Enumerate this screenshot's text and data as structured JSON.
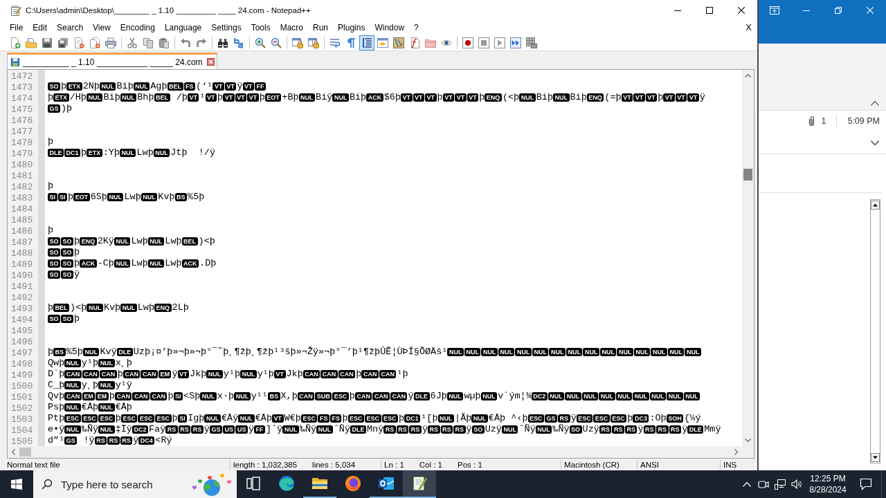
{
  "editor_window": {
    "title": "C:\\Users\\admin\\Desktop\\________ _ 1.10 _________ ____ 24.com - Notepad++",
    "menu": [
      "File",
      "Edit",
      "Search",
      "View",
      "Encoding",
      "Language",
      "Settings",
      "Tools",
      "Macro",
      "Run",
      "Plugins",
      "Window",
      "?"
    ],
    "menu_close": "X",
    "toolbar": [
      {
        "on": false
      },
      {
        "on": false
      },
      {
        "on": false
      },
      {
        "on": false
      },
      {
        "on": false
      },
      {
        "on": false
      },
      {
        "on": false
      },
      {
        "on": false
      },
      {
        "on": false
      },
      {
        "on": false
      },
      {
        "on": false
      },
      {
        "on": false
      },
      {
        "on": false
      },
      {
        "on": false
      },
      {
        "on": false
      },
      {
        "on": false
      },
      {
        "on": false
      },
      {
        "on": false
      },
      {
        "on": false
      },
      {
        "on": false
      },
      {
        "on": true
      },
      {
        "on": false
      },
      {
        "on": false
      },
      {
        "on": false
      },
      {
        "on": false
      },
      {
        "on": false
      },
      {
        "on": false
      },
      {
        "on": false
      },
      {
        "on": false
      },
      {
        "on": false
      },
      {
        "on": false
      }
    ],
    "tabs": [
      {
        "label": "__________ _ 1.10 ___________ _____ 24.com",
        "selected": true
      }
    ],
    "lines": [
      {
        "number": "1472"
      },
      {
        "number": "1473",
        "segments": [
          {
            "kind": "ctrl",
            "text": "SO"
          },
          {
            "kind": "text",
            "text": "þ"
          },
          {
            "kind": "ctrl",
            "text": "ETX"
          },
          {
            "kind": "text",
            "text": "2Nþ"
          },
          {
            "kind": "ctrl",
            "text": "NUL"
          },
          {
            "kind": "text",
            "text": "Biþ"
          },
          {
            "kind": "ctrl",
            "text": "NUL"
          },
          {
            "kind": "text",
            "text": "Agþ"
          },
          {
            "kind": "ctrl",
            "text": "BEL"
          },
          {
            "kind": "ctrl",
            "text": "FS"
          },
          {
            "kind": "text",
            "text": "(‘¹"
          },
          {
            "kind": "ctrl",
            "text": "VT"
          },
          {
            "kind": "ctrl",
            "text": "VT"
          },
          {
            "kind": "text",
            "text": "ÿ"
          },
          {
            "kind": "ctrl",
            "text": "VT"
          },
          {
            "kind": "ctrl",
            "text": "FF"
          }
        ]
      },
      {
        "number": "1474",
        "segments": [
          {
            "kind": "text",
            "text": "þ"
          },
          {
            "kind": "ctrl",
            "text": "ETX"
          },
          {
            "kind": "text",
            "text": "/Hþ"
          },
          {
            "kind": "ctrl",
            "text": "NUL"
          },
          {
            "kind": "text",
            "text": "Biþ"
          },
          {
            "kind": "ctrl",
            "text": "NUL"
          },
          {
            "kind": "text",
            "text": "Bhþ"
          },
          {
            "kind": "ctrl",
            "text": "BEL"
          },
          {
            "kind": "text",
            "text": " /þ"
          },
          {
            "kind": "ctrl",
            "text": "VT"
          },
          {
            "kind": "text",
            "text": "¹"
          },
          {
            "kind": "ctrl",
            "text": "VT"
          },
          {
            "kind": "text",
            "text": "þ"
          },
          {
            "kind": "ctrl",
            "text": "VT"
          },
          {
            "kind": "ctrl",
            "text": "VT"
          },
          {
            "kind": "ctrl",
            "text": "VT"
          },
          {
            "kind": "text",
            "text": "þ"
          },
          {
            "kind": "ctrl",
            "text": "EOT"
          },
          {
            "kind": "text",
            "text": "+Bþ"
          },
          {
            "kind": "ctrl",
            "text": "NUL"
          },
          {
            "kind": "text",
            "text": "Biÿ"
          },
          {
            "kind": "ctrl",
            "text": "NUL"
          },
          {
            "kind": "text",
            "text": "Biþ"
          },
          {
            "kind": "ctrl",
            "text": "ACK"
          },
          {
            "kind": "text",
            "text": "$6þ"
          },
          {
            "kind": "ctrl",
            "text": "VT"
          },
          {
            "kind": "ctrl",
            "text": "VT"
          },
          {
            "kind": "ctrl",
            "text": "VT"
          },
          {
            "kind": "text",
            "text": "þ"
          },
          {
            "kind": "ctrl",
            "text": "VT"
          },
          {
            "kind": "ctrl",
            "text": "VT"
          },
          {
            "kind": "ctrl",
            "text": "VT"
          },
          {
            "kind": "text",
            "text": "þ"
          },
          {
            "kind": "ctrl",
            "text": "ENQ"
          },
          {
            "kind": "text",
            "text": "(<þ"
          },
          {
            "kind": "ctrl",
            "text": "NUL"
          },
          {
            "kind": "text",
            "text": "Biþ"
          },
          {
            "kind": "ctrl",
            "text": "NUL"
          },
          {
            "kind": "text",
            "text": "Biþ"
          },
          {
            "kind": "ctrl",
            "text": "ENQ"
          },
          {
            "kind": "text",
            "text": "(=þ"
          },
          {
            "kind": "ctrl",
            "text": "VT"
          },
          {
            "kind": "ctrl",
            "text": "VT"
          },
          {
            "kind": "ctrl",
            "text": "VT"
          },
          {
            "kind": "text",
            "text": "þ"
          },
          {
            "kind": "ctrl",
            "text": "VT"
          },
          {
            "kind": "ctrl",
            "text": "VT"
          },
          {
            "kind": "ctrl",
            "text": "VT"
          },
          {
            "kind": "text",
            "text": "ÿ"
          }
        ]
      },
      {
        "number": "1475",
        "segments": [
          {
            "kind": "ctrl",
            "text": "GS"
          },
          {
            "kind": "text",
            "text": ")þ"
          }
        ]
      },
      {
        "number": "1476"
      },
      {
        "number": "1477"
      },
      {
        "number": "1478",
        "segments": [
          {
            "kind": "text",
            "text": "þ"
          }
        ]
      },
      {
        "number": "1479",
        "segments": [
          {
            "kind": "ctrl",
            "text": "DLE"
          },
          {
            "kind": "ctrl",
            "text": "DC1"
          },
          {
            "kind": "text",
            "text": "þ"
          },
          {
            "kind": "ctrl",
            "text": "ETX"
          },
          {
            "kind": "text",
            "text": ":Yþ"
          },
          {
            "kind": "ctrl",
            "text": "NUL"
          },
          {
            "kind": "text",
            "text": "Lwþ"
          },
          {
            "kind": "ctrl",
            "text": "NUL"
          },
          {
            "kind": "text",
            "text": "Jtþ  !/ÿ"
          }
        ]
      },
      {
        "number": "1480"
      },
      {
        "number": "1481"
      },
      {
        "number": "1482",
        "segments": [
          {
            "kind": "text",
            "text": "þ"
          }
        ]
      },
      {
        "number": "1483",
        "segments": [
          {
            "kind": "ctrl",
            "text": "SI"
          },
          {
            "kind": "ctrl",
            "text": "SI"
          },
          {
            "kind": "text",
            "text": "þ"
          },
          {
            "kind": "ctrl",
            "text": "EOT"
          },
          {
            "kind": "text",
            "text": "6Sþ"
          },
          {
            "kind": "ctrl",
            "text": "NUL"
          },
          {
            "kind": "text",
            "text": "Lwþ"
          },
          {
            "kind": "ctrl",
            "text": "NUL"
          },
          {
            "kind": "text",
            "text": "Kvþ"
          },
          {
            "kind": "ctrl",
            "text": "BS"
          },
          {
            "kind": "text",
            "text": "%5þ"
          }
        ]
      },
      {
        "number": "1484"
      },
      {
        "number": "1485"
      },
      {
        "number": "1486",
        "segments": [
          {
            "kind": "text",
            "text": "þ"
          }
        ]
      },
      {
        "number": "1487",
        "segments": [
          {
            "kind": "ctrl",
            "text": "SO"
          },
          {
            "kind": "ctrl",
            "text": "SO"
          },
          {
            "kind": "text",
            "text": "þ"
          },
          {
            "kind": "ctrl",
            "text": "ENQ"
          },
          {
            "kind": "text",
            "text": "2Kÿ"
          },
          {
            "kind": "ctrl",
            "text": "NUL"
          },
          {
            "kind": "text",
            "text": "Lwþ"
          },
          {
            "kind": "ctrl",
            "text": "NUL"
          },
          {
            "kind": "text",
            "text": "Lwþ"
          },
          {
            "kind": "ctrl",
            "text": "BEL"
          },
          {
            "kind": "text",
            "text": ")<þ"
          }
        ]
      },
      {
        "number": "1488",
        "segments": [
          {
            "kind": "ctrl",
            "text": "SO"
          },
          {
            "kind": "ctrl",
            "text": "SO"
          },
          {
            "kind": "text",
            "text": "þ"
          }
        ]
      },
      {
        "number": "1489",
        "segments": [
          {
            "kind": "ctrl",
            "text": "SO"
          },
          {
            "kind": "ctrl",
            "text": "SO"
          },
          {
            "kind": "text",
            "text": "þ"
          },
          {
            "kind": "ctrl",
            "text": "ACK"
          },
          {
            "kind": "text",
            "text": "-Cþ"
          },
          {
            "kind": "ctrl",
            "text": "NUL"
          },
          {
            "kind": "text",
            "text": "Lwþ"
          },
          {
            "kind": "ctrl",
            "text": "NUL"
          },
          {
            "kind": "text",
            "text": "Lwþ"
          },
          {
            "kind": "ctrl",
            "text": "ACK"
          },
          {
            "kind": "text",
            "text": ".Dþ"
          }
        ]
      },
      {
        "number": "1490",
        "segments": [
          {
            "kind": "ctrl",
            "text": "SO"
          },
          {
            "kind": "ctrl",
            "text": "SO"
          },
          {
            "kind": "text",
            "text": "ÿ"
          }
        ]
      },
      {
        "number": "1491"
      },
      {
        "number": "1492"
      },
      {
        "number": "1493",
        "segments": [
          {
            "kind": "text",
            "text": "þ"
          },
          {
            "kind": "ctrl",
            "text": "BEL"
          },
          {
            "kind": "text",
            "text": ")<þ"
          },
          {
            "kind": "ctrl",
            "text": "NUL"
          },
          {
            "kind": "text",
            "text": "Kvþ"
          },
          {
            "kind": "ctrl",
            "text": "NUL"
          },
          {
            "kind": "text",
            "text": "Lwþ"
          },
          {
            "kind": "ctrl",
            "text": "ENQ"
          },
          {
            "kind": "text",
            "text": "2Lþ"
          }
        ]
      },
      {
        "number": "1494",
        "segments": [
          {
            "kind": "ctrl",
            "text": "SO"
          },
          {
            "kind": "ctrl",
            "text": "SO"
          },
          {
            "kind": "text",
            "text": "þ"
          }
        ]
      },
      {
        "number": "1495"
      },
      {
        "number": "1496"
      },
      {
        "number": "1497",
        "segments": [
          {
            "kind": "text",
            "text": "þ"
          },
          {
            "kind": "ctrl",
            "text": "BS"
          },
          {
            "kind": "text",
            "text": "%5þ"
          },
          {
            "kind": "ctrl",
            "text": "NUL"
          },
          {
            "kind": "text",
            "text": "Kvÿ"
          },
          {
            "kind": "ctrl",
            "text": "DLE"
          },
          {
            "kind": "text",
            "text": "Uzþ¡¤’þ»¬þ»¬þ°¯˜þ¸¶žþ¸¶žþ¹³šþ»¬Žÿ»¬þ°¯’þ¹¶žþÛÊ¦ÙÞÍ§ÕØÄš¹"
          },
          {
            "kind": "ctrl",
            "text": "NUL"
          },
          {
            "kind": "ctrl",
            "text": "NUL"
          },
          {
            "kind": "ctrl",
            "text": "NUL"
          },
          {
            "kind": "ctrl",
            "text": "NUL"
          },
          {
            "kind": "ctrl",
            "text": "NUL"
          },
          {
            "kind": "ctrl",
            "text": "NUL"
          },
          {
            "kind": "ctrl",
            "text": "NUL"
          },
          {
            "kind": "ctrl",
            "text": "NUL"
          },
          {
            "kind": "ctrl",
            "text": "NUL"
          },
          {
            "kind": "ctrl",
            "text": "NUL"
          },
          {
            "kind": "ctrl",
            "text": "NUL"
          },
          {
            "kind": "ctrl",
            "text": "NUL"
          },
          {
            "kind": "ctrl",
            "text": "NUL"
          },
          {
            "kind": "ctrl",
            "text": "NUL"
          },
          {
            "kind": "ctrl",
            "text": "NUL"
          }
        ]
      },
      {
        "number": "1498",
        "segments": [
          {
            "kind": "text",
            "text": "Qwþ"
          },
          {
            "kind": "ctrl",
            "text": "NUL"
          },
          {
            "kind": "text",
            "text": "y¹þ"
          },
          {
            "kind": "ctrl",
            "text": "NUL"
          },
          {
            "kind": "text",
            "text": "x¸þ"
          }
        ]
      },
      {
        "number": "1499",
        "segments": [
          {
            "kind": "text",
            "text": "D`þ"
          },
          {
            "kind": "ctrl",
            "text": "CAN"
          },
          {
            "kind": "ctrl",
            "text": "CAN"
          },
          {
            "kind": "ctrl",
            "text": "CAN"
          },
          {
            "kind": "text",
            "text": "þ"
          },
          {
            "kind": "ctrl",
            "text": "CAN"
          },
          {
            "kind": "ctrl",
            "text": "CAN"
          },
          {
            "kind": "ctrl",
            "text": "EM"
          },
          {
            "kind": "text",
            "text": "ÿ"
          },
          {
            "kind": "ctrl",
            "text": "VT"
          },
          {
            "kind": "text",
            "text": "Jkþ"
          },
          {
            "kind": "ctrl",
            "text": "NUL"
          },
          {
            "kind": "text",
            "text": "y¹þ"
          },
          {
            "kind": "ctrl",
            "text": "NUL"
          },
          {
            "kind": "text",
            "text": "y¹þ"
          },
          {
            "kind": "ctrl",
            "text": "VT"
          },
          {
            "kind": "text",
            "text": "Jkþ"
          },
          {
            "kind": "ctrl",
            "text": "CAN"
          },
          {
            "kind": "ctrl",
            "text": "CAN"
          },
          {
            "kind": "ctrl",
            "text": "CAN"
          },
          {
            "kind": "text",
            "text": "þ"
          },
          {
            "kind": "ctrl",
            "text": "CAN"
          },
          {
            "kind": "ctrl",
            "text": "CAN"
          },
          {
            "kind": "text",
            "text": "¹þ"
          }
        ]
      },
      {
        "number": "1500",
        "segments": [
          {
            "kind": "text",
            "text": "C_þ"
          },
          {
            "kind": "ctrl",
            "text": "NUL"
          },
          {
            "kind": "text",
            "text": "y¸þ"
          },
          {
            "kind": "ctrl",
            "text": "NUL"
          },
          {
            "kind": "text",
            "text": "y¹ÿ"
          }
        ]
      },
      {
        "number": "1501",
        "segments": [
          {
            "kind": "text",
            "text": "Qvþ"
          },
          {
            "kind": "ctrl",
            "text": "CAN"
          },
          {
            "kind": "ctrl",
            "text": "EM"
          },
          {
            "kind": "ctrl",
            "text": "EM"
          },
          {
            "kind": "text",
            "text": "þ"
          },
          {
            "kind": "ctrl",
            "text": "CAN"
          },
          {
            "kind": "ctrl",
            "text": "CAN"
          },
          {
            "kind": "ctrl",
            "text": "CAN"
          },
          {
            "kind": "text",
            "text": "þ"
          },
          {
            "kind": "ctrl",
            "text": "SI"
          },
          {
            "kind": "text",
            "text": "<Sþ"
          },
          {
            "kind": "ctrl",
            "text": "NUL"
          },
          {
            "kind": "text",
            "text": "x·þ"
          },
          {
            "kind": "ctrl",
            "text": "NUL"
          },
          {
            "kind": "text",
            "text": "y¹¹"
          },
          {
            "kind": "ctrl",
            "text": "BS"
          },
          {
            "kind": "text",
            "text": "X,þ"
          },
          {
            "kind": "ctrl",
            "text": "CAN"
          },
          {
            "kind": "ctrl",
            "text": "SUB"
          },
          {
            "kind": "ctrl",
            "text": "ESC"
          },
          {
            "kind": "text",
            "text": "þ"
          },
          {
            "kind": "ctrl",
            "text": "CAN"
          },
          {
            "kind": "ctrl",
            "text": "CAN"
          },
          {
            "kind": "ctrl",
            "text": "CAN"
          },
          {
            "kind": "text",
            "text": "ÿ"
          },
          {
            "kind": "ctrl",
            "text": "DLE"
          },
          {
            "kind": "text",
            "text": "6Jþ"
          },
          {
            "kind": "ctrl",
            "text": "NUL"
          },
          {
            "kind": "text",
            "text": "wµþ"
          },
          {
            "kind": "ctrl",
            "text": "NUL"
          },
          {
            "kind": "text",
            "text": "v´ým¦¾"
          },
          {
            "kind": "ctrl",
            "text": "DC2"
          },
          {
            "kind": "ctrl",
            "text": "NUL"
          },
          {
            "kind": "ctrl",
            "text": "NUL"
          },
          {
            "kind": "ctrl",
            "text": "NUL"
          },
          {
            "kind": "ctrl",
            "text": "NUL"
          },
          {
            "kind": "ctrl",
            "text": "NUL"
          },
          {
            "kind": "ctrl",
            "text": "NUL"
          },
          {
            "kind": "ctrl",
            "text": "NUL"
          },
          {
            "kind": "ctrl",
            "text": "NUL"
          },
          {
            "kind": "ctrl",
            "text": "NUL"
          }
        ]
      },
      {
        "number": "1502",
        "segments": [
          {
            "kind": "text",
            "text": "Psþ"
          },
          {
            "kind": "ctrl",
            "text": "NUL"
          },
          {
            "kind": "text",
            "text": "€Åþ"
          },
          {
            "kind": "ctrl",
            "text": "NUL"
          },
          {
            "kind": "text",
            "text": "€Åþ"
          }
        ]
      },
      {
        "number": "1503",
        "segments": [
          {
            "kind": "text",
            "text": "Ptþ"
          },
          {
            "kind": "ctrl",
            "text": "ESC"
          },
          {
            "kind": "ctrl",
            "text": "ESC"
          },
          {
            "kind": "ctrl",
            "text": "ESC"
          },
          {
            "kind": "text",
            "text": "þ"
          },
          {
            "kind": "ctrl",
            "text": "ESC"
          },
          {
            "kind": "ctrl",
            "text": "ESC"
          },
          {
            "kind": "ctrl",
            "text": "ESC"
          },
          {
            "kind": "text",
            "text": "þ"
          },
          {
            "kind": "ctrl",
            "text": "SI"
          },
          {
            "kind": "text",
            "text": "Igþ"
          },
          {
            "kind": "ctrl",
            "text": "NUL"
          },
          {
            "kind": "text",
            "text": "€Åÿ"
          },
          {
            "kind": "ctrl",
            "text": "NUL"
          },
          {
            "kind": "text",
            "text": "€Åþ"
          },
          {
            "kind": "ctrl",
            "text": "VT"
          },
          {
            "kind": "text",
            "text": "W€þ"
          },
          {
            "kind": "ctrl",
            "text": "ESC"
          },
          {
            "kind": "ctrl",
            "text": "FS"
          },
          {
            "kind": "ctrl",
            "text": "FS"
          },
          {
            "kind": "text",
            "text": "þ"
          },
          {
            "kind": "ctrl",
            "text": "ESC"
          },
          {
            "kind": "ctrl",
            "text": "ESC"
          },
          {
            "kind": "ctrl",
            "text": "ESC"
          },
          {
            "kind": "text",
            "text": "þ"
          },
          {
            "kind": "ctrl",
            "text": "DC1"
          },
          {
            "kind": "text",
            "text": "¹[þ"
          },
          {
            "kind": "ctrl",
            "text": "NUL"
          },
          {
            "kind": "text",
            "text": "|Ãþ"
          },
          {
            "kind": "ctrl",
            "text": "NUL"
          },
          {
            "kind": "text",
            "text": "€Åþ ^‹þ"
          },
          {
            "kind": "ctrl",
            "text": "ESC"
          },
          {
            "kind": "ctrl",
            "text": "GS"
          },
          {
            "kind": "ctrl",
            "text": "RS"
          },
          {
            "kind": "text",
            "text": "ÿ"
          },
          {
            "kind": "ctrl",
            "text": "ESC"
          },
          {
            "kind": "ctrl",
            "text": "ESC"
          },
          {
            "kind": "ctrl",
            "text": "ESC"
          },
          {
            "kind": "text",
            "text": "þ"
          },
          {
            "kind": "ctrl",
            "text": "DC3"
          },
          {
            "kind": "text",
            "text": ":Oþ"
          },
          {
            "kind": "ctrl",
            "text": "SOH"
          },
          {
            "kind": "text",
            "text": "{¼ý"
          }
        ]
      },
      {
        "number": "1504",
        "segments": [
          {
            "kind": "text",
            "text": "e•ÿ"
          },
          {
            "kind": "ctrl",
            "text": "NUL"
          },
          {
            "kind": "text",
            "text": "‰Ñÿ"
          },
          {
            "kind": "ctrl",
            "text": "NUL"
          },
          {
            "kind": "text",
            "text": "‡Ïÿ"
          },
          {
            "kind": "ctrl",
            "text": "DC2"
          },
          {
            "kind": "text",
            "text": "Faÿ"
          },
          {
            "kind": "ctrl",
            "text": "RS"
          },
          {
            "kind": "ctrl",
            "text": "RS"
          },
          {
            "kind": "ctrl",
            "text": "RS"
          },
          {
            "kind": "text",
            "text": "ÿ"
          },
          {
            "kind": "ctrl",
            "text": "GS"
          },
          {
            "kind": "ctrl",
            "text": "US"
          },
          {
            "kind": "ctrl",
            "text": "US"
          },
          {
            "kind": "text",
            "text": "ÿ"
          },
          {
            "kind": "ctrl",
            "text": "FF"
          },
          {
            "kind": "text",
            "text": "]ˆÿ"
          },
          {
            "kind": "ctrl",
            "text": "NUL"
          },
          {
            "kind": "text",
            "text": "‰Ñÿ"
          },
          {
            "kind": "ctrl",
            "text": "NUL"
          },
          {
            "kind": "text",
            "text": "ˆÑÿ"
          },
          {
            "kind": "ctrl",
            "text": "DLE"
          },
          {
            "kind": "text",
            "text": "Mnÿ"
          },
          {
            "kind": "ctrl",
            "text": "RS"
          },
          {
            "kind": "ctrl",
            "text": "RS"
          },
          {
            "kind": "ctrl",
            "text": "RS"
          },
          {
            "kind": "text",
            "text": "ÿ"
          },
          {
            "kind": "ctrl",
            "text": "RS"
          },
          {
            "kind": "ctrl",
            "text": "RS"
          },
          {
            "kind": "ctrl",
            "text": "RS"
          },
          {
            "kind": "text",
            "text": "ÿ"
          },
          {
            "kind": "ctrl",
            "text": "SO"
          },
          {
            "kind": "text",
            "text": "Uzÿ"
          },
          {
            "kind": "ctrl",
            "text": "NUL"
          },
          {
            "kind": "text",
            "text": "ˆÑÿ"
          },
          {
            "kind": "ctrl",
            "text": "NUL"
          },
          {
            "kind": "text",
            "text": "‰Ñÿ"
          },
          {
            "kind": "ctrl",
            "text": "SO"
          },
          {
            "kind": "text",
            "text": "Uzÿ"
          },
          {
            "kind": "ctrl",
            "text": "RS"
          },
          {
            "kind": "ctrl",
            "text": "RS"
          },
          {
            "kind": "ctrl",
            "text": "RS"
          },
          {
            "kind": "text",
            "text": "ÿ"
          },
          {
            "kind": "ctrl",
            "text": "RS"
          },
          {
            "kind": "ctrl",
            "text": "RS"
          },
          {
            "kind": "ctrl",
            "text": "RS"
          },
          {
            "kind": "text",
            "text": "ÿ"
          },
          {
            "kind": "ctrl",
            "text": "DLE"
          },
          {
            "kind": "text",
            "text": "Mmÿ"
          }
        ]
      },
      {
        "number": "1505",
        "segments": [
          {
            "kind": "text",
            "text": "d”¹"
          },
          {
            "kind": "ctrl",
            "text": "GS"
          },
          {
            "kind": "text",
            "text": " !ÿ"
          },
          {
            "kind": "ctrl",
            "text": "RS"
          },
          {
            "kind": "ctrl",
            "text": "RS"
          },
          {
            "kind": "ctrl",
            "text": "RS"
          },
          {
            "kind": "text",
            "text": "ÿ"
          },
          {
            "kind": "ctrl",
            "text": "DC4"
          },
          {
            "kind": "text",
            "text": "<Rý"
          }
        ]
      }
    ],
    "status_bar": [
      {
        "parts": [
          "Normal text file"
        ]
      },
      {
        "parts": [
          "length : 1,032,385",
          "lines : 5,034"
        ]
      },
      {
        "parts": [
          "Ln : 1",
          "Col : 1",
          "Pos : 1"
        ]
      },
      {
        "parts": [
          "Macintosh (CR)"
        ]
      },
      {
        "parts": [
          "ANSI"
        ]
      },
      {
        "parts": [
          "INS"
        ]
      }
    ]
  },
  "mail_window": {
    "attachment_count": "1",
    "time": "5:09 PM"
  },
  "taskbar": {
    "search": {
      "placeholder": "Type here to search"
    },
    "apps": [
      {
        "running": false,
        "selected": false
      },
      {
        "running": true,
        "selected": false
      },
      {
        "running": false,
        "selected": false
      },
      {
        "running": true,
        "selected": false
      },
      {
        "running": true,
        "selected": true
      }
    ],
    "clock": {
      "time": "12:25 PM",
      "date": "8/28/2024"
    }
  }
}
